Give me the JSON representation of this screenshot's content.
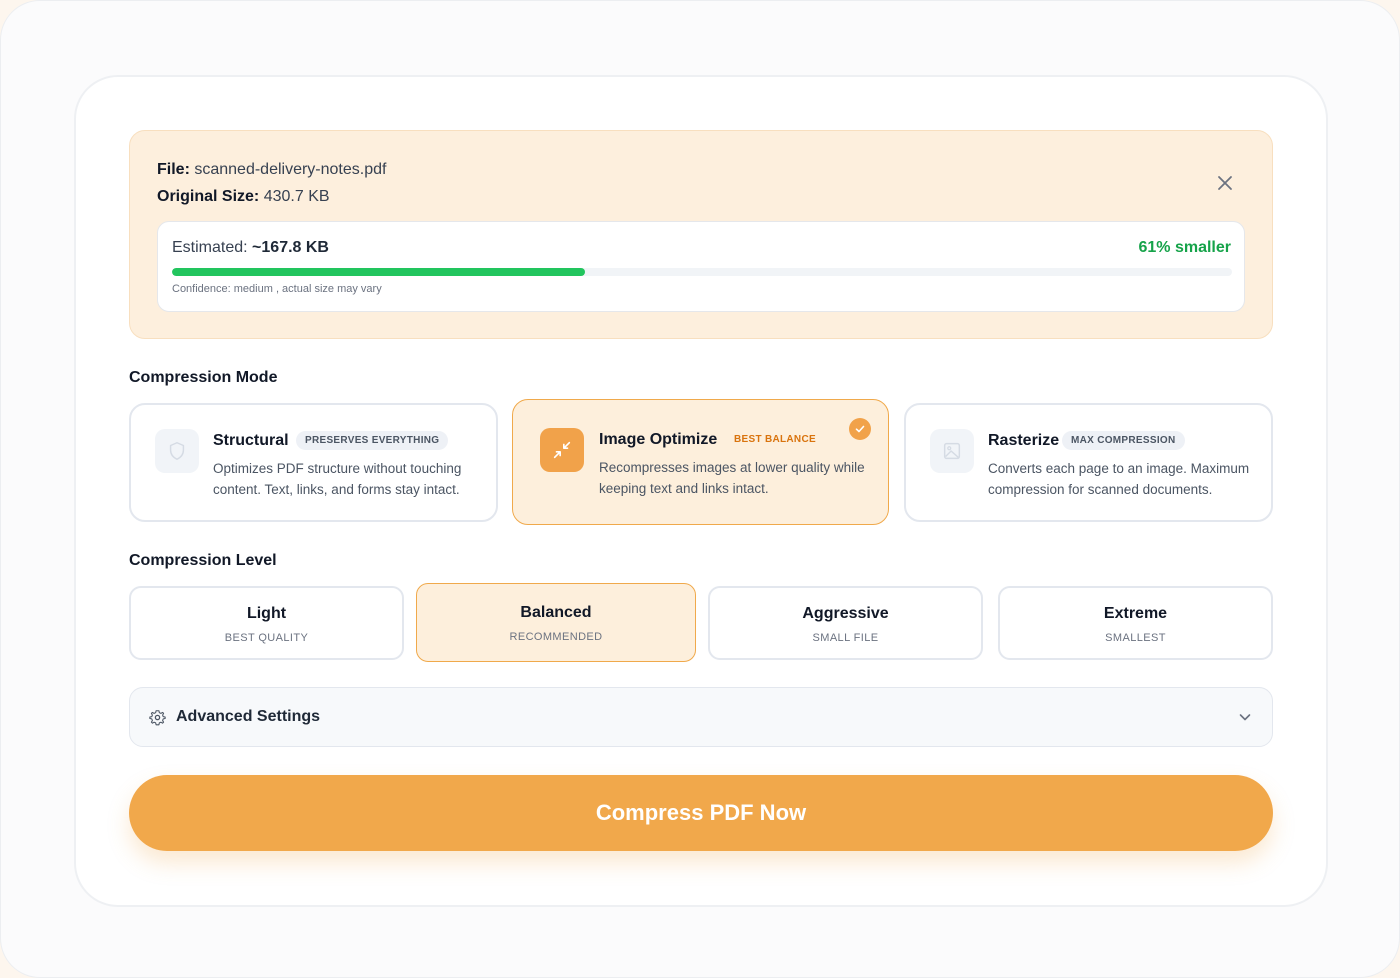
{
  "file": {
    "name_label": "File:",
    "name": "scanned-delivery-notes.pdf",
    "size_label": "Original Size:",
    "size": "430.7 KB"
  },
  "estimate": {
    "label": "Estimated:",
    "value": "~167.8 KB",
    "reduction": "61% smaller",
    "progress_fraction": 0.39,
    "confidence": "Confidence: medium , actual size may vary"
  },
  "modes": {
    "title": "Compression Mode",
    "items": [
      {
        "title": "Structural",
        "badge": "PRESERVES EVERYTHING",
        "desc": "Optimizes PDF structure without touching content. Text, links, and forms stay intact.",
        "icon": "shield-icon",
        "selected": false
      },
      {
        "title": "Image Optimize",
        "badge": "BEST BALANCE",
        "desc": "Recompresses images at lower quality while keeping text and links intact.",
        "icon": "compress-arrows-icon",
        "selected": true
      },
      {
        "title": "Rasterize",
        "badge": "MAX COMPRESSION",
        "desc": "Converts each page to an image. Maximum compression for scanned documents.",
        "icon": "image-icon",
        "selected": false
      }
    ]
  },
  "levels": {
    "title": "Compression Level",
    "items": [
      {
        "title": "Light",
        "sub": "BEST QUALITY",
        "selected": false
      },
      {
        "title": "Balanced",
        "sub": "RECOMMENDED",
        "selected": true
      },
      {
        "title": "Aggressive",
        "sub": "SMALL FILE",
        "selected": false
      },
      {
        "title": "Extreme",
        "sub": "SMALLEST",
        "selected": false
      }
    ]
  },
  "advanced": {
    "label": "Advanced Settings",
    "icon": "gear-icon"
  },
  "cta": {
    "label": "Compress PDF Now"
  },
  "colors": {
    "accent": "#f1a84b",
    "success": "#22c55e",
    "panel": "#fdefdd"
  }
}
